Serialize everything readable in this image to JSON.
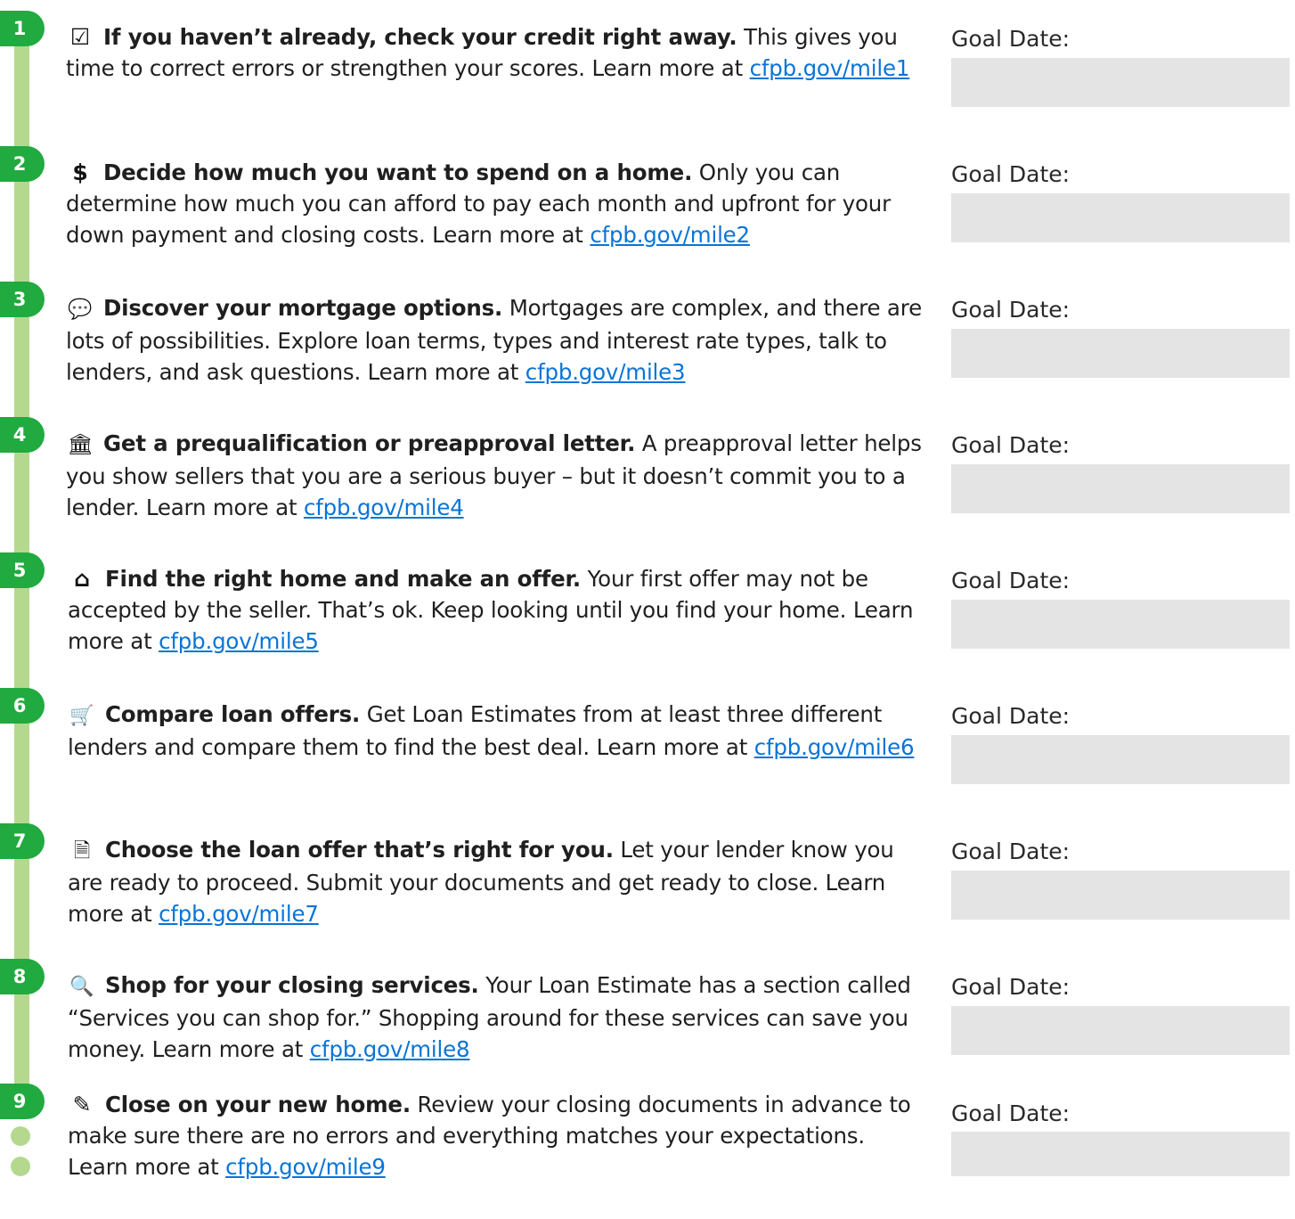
{
  "goal_label": "Goal Date:",
  "colors": {
    "badge_green": "#20aa3f",
    "rail_green": "#b4d98e",
    "link_blue": "#0a74d6",
    "field_gray": "#e4e4e4"
  },
  "milestones": [
    {
      "number": "1",
      "icon": "checklist-icon",
      "glyph": "☑",
      "title": "If you haven’t already, check your credit right away.",
      "body": "This gives you time to correct errors or strengthen your scores. Learn more at",
      "link": "cfpb.gov/mile1",
      "goal_value": ""
    },
    {
      "number": "2",
      "icon": "dollar-icon",
      "glyph": "$",
      "title": "Decide how much you want to spend on a home.",
      "body": "Only you can determine how much you can afford to pay each month and upfront for your down payment and closing costs. Learn more at",
      "link": "cfpb.gov/mile2",
      "goal_value": ""
    },
    {
      "number": "3",
      "icon": "speech-bubbles-icon",
      "glyph": "💬",
      "title": "Discover your mortgage options.",
      "body": "Mortgages are complex, and there are lots of possibilities. Explore loan terms, types and interest rate types, talk to lenders, and ask questions. Learn more at",
      "link": "cfpb.gov/mile3",
      "goal_value": ""
    },
    {
      "number": "4",
      "icon": "bank-icon",
      "glyph": "🏛",
      "title": "Get a prequalification or preapproval letter.",
      "body": "A preapproval letter helps you show sellers that you are a serious buyer – but it doesn’t commit you to a lender. Learn more at",
      "link": "cfpb.gov/mile4",
      "goal_value": ""
    },
    {
      "number": "5",
      "icon": "house-icon",
      "glyph": "⌂",
      "title": "Find the right home and make an offer.",
      "body": "Your first offer may not be accepted by the seller. That’s ok. Keep looking until you find your home. Learn more at",
      "link": "cfpb.gov/mile5",
      "goal_value": ""
    },
    {
      "number": "6",
      "icon": "shopping-cart-icon",
      "glyph": "🛒",
      "title": "Compare loan offers.",
      "body": "Get Loan Estimates from at least three different lenders and compare them to find the best deal. Learn more at",
      "link": "cfpb.gov/mile6",
      "goal_value": ""
    },
    {
      "number": "7",
      "icon": "document-icon",
      "glyph": "🗎",
      "title": "Choose the loan offer that’s right for you.",
      "body": "Let your lender know you are ready to proceed. Submit your documents and get ready to close. Learn more at",
      "link": "cfpb.gov/mile7",
      "goal_value": ""
    },
    {
      "number": "8",
      "icon": "magnifier-icon",
      "glyph": "🔍",
      "title": "Shop for your closing services.",
      "body": "Your Loan Estimate has a section called “Services you can shop for.” Shopping around for these services can save you money. Learn more at",
      "link": "cfpb.gov/mile8",
      "goal_value": ""
    },
    {
      "number": "9",
      "icon": "pencil-icon",
      "glyph": "✎",
      "title": "Close on your new home.",
      "body": "Review your closing documents in advance to make sure there are no errors and everything matches your expectations. Learn more at",
      "link": "cfpb.gov/mile9",
      "goal_value": ""
    }
  ]
}
